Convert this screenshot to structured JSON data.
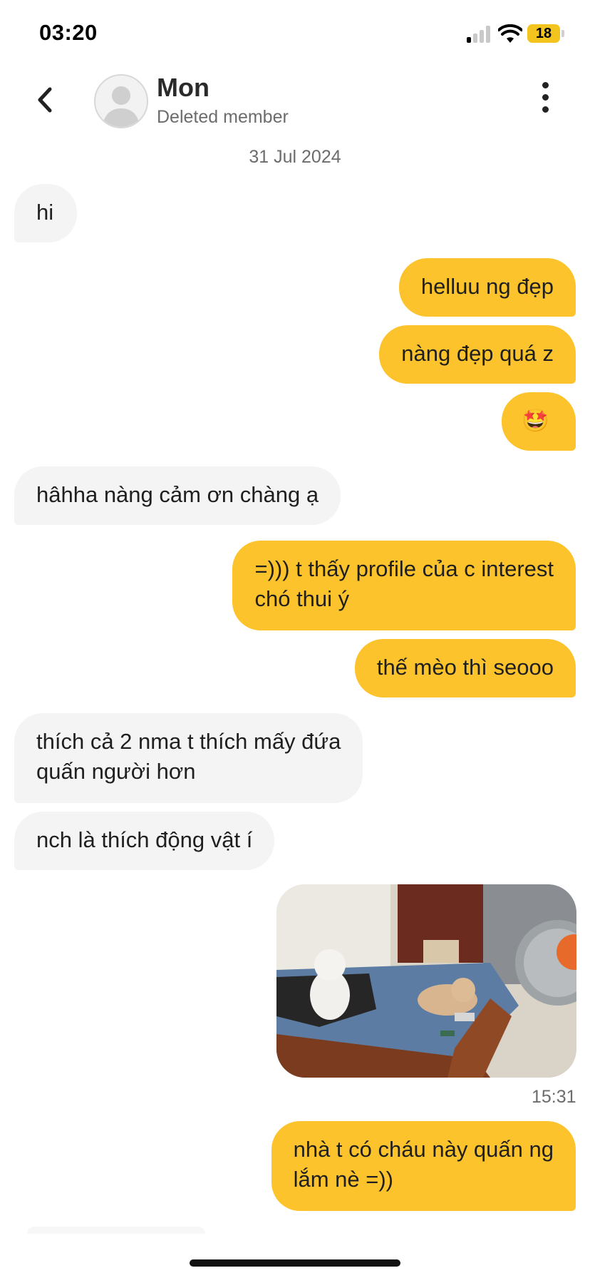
{
  "status_bar": {
    "time": "03:20",
    "battery": "18"
  },
  "header": {
    "name": "Mon",
    "status": "Deleted member"
  },
  "date_separator": "31 Jul 2024",
  "messages": [
    {
      "text": "hi"
    },
    {
      "text": "helluu ng đẹp"
    },
    {
      "text": "nàng đẹp quá z"
    },
    {
      "text": "🤩"
    },
    {
      "text": "hâhha nàng cảm ơn chàng ạ"
    },
    {
      "text": "=))) t thấy profile của c interest\nchó thui ý"
    },
    {
      "text": "thế mèo thì seooo"
    },
    {
      "text": "thích cả 2 nma t thích mấy đứa\nquấn người hơn"
    },
    {
      "text": "nch là thích động vật í"
    },
    {
      "text": "nhà t có cháu này quấn ng\nlắm nè =))"
    }
  ],
  "photo_message": {
    "time": "15:31"
  },
  "colors": {
    "outgoing": "#fdc32c",
    "incoming": "#f4f4f4",
    "battery": "#f3c31e"
  }
}
